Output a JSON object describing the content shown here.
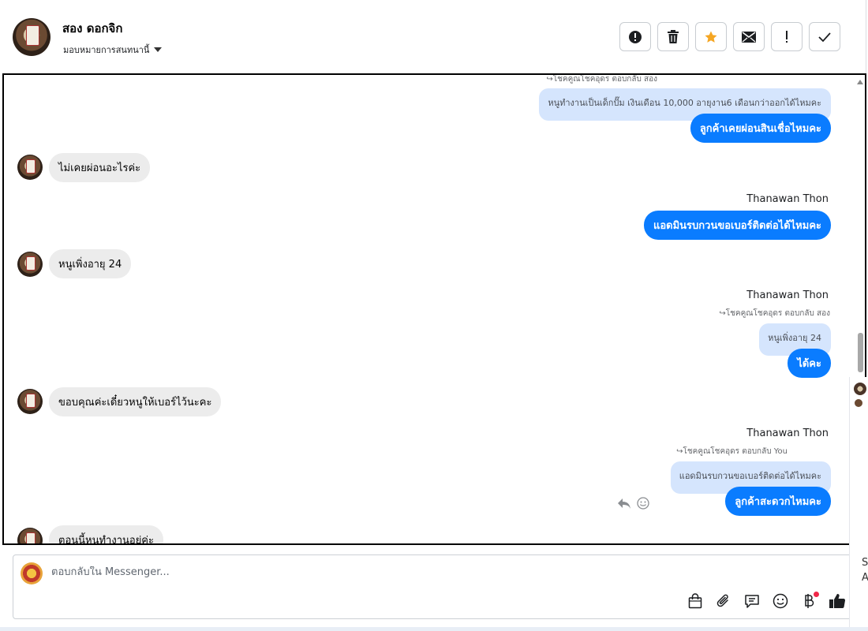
{
  "header": {
    "contact_name": "สอง ดอกจิก",
    "assign_label": "มอบหมายการสนทนานี้"
  },
  "toolbar": {
    "buttons": [
      "exclamation-circle-icon",
      "trash-icon",
      "star-icon",
      "envelope-icon",
      "exclamation-icon",
      "check-icon"
    ],
    "accent_star": "#f5a623"
  },
  "messages": {
    "m1": {
      "reply_meta": "↪โชคคูณโชคอุดร ตอบกลับ สอง",
      "quoted": "หนูทำงานเป็นเด็กปั๊ม เงินเดือน 10,000 อายุงาน6 เดือนกว่าออกได้ไหมคะ",
      "text": "ลูกค้าเคยผ่อนสินเชื่อไหมคะ"
    },
    "m2": {
      "text": "ไม่เคยผ่อนอะไรค่ะ"
    },
    "m3": {
      "sender": "Thanawan Thon",
      "text": "แอดมินรบกวนขอเบอร์ติดต่อได้ไหมคะ"
    },
    "m4": {
      "text": "หนูเพิ่งอายุ 24"
    },
    "m5": {
      "sender": "Thanawan Thon",
      "reply_meta": "↪โชคคูณโชคอุดร ตอบกลับ สอง",
      "quoted": "หนูเพิ่งอายุ 24",
      "text": "ได้คะ"
    },
    "m6": {
      "text": "ขอบคุณค่ะเดี๋ยวหนูให้เบอร์ไว้นะคะ"
    },
    "m7": {
      "sender": "Thanawan Thon",
      "reply_meta": "↪โชคคูณโชคอุดร ตอบกลับ You",
      "quoted": "แอดมินรบกวนขอเบอร์ติดต่อได้ไหมคะ",
      "text": "ลูกค้าสะดวกไหมคะ"
    },
    "m8": {
      "text": "ตอนนี้หนูทำงานอยู่ค่ะ"
    }
  },
  "composer": {
    "placeholder": "ตอบกลับใน Messenger...",
    "tools": [
      "shopping-bag-icon",
      "paperclip-icon",
      "saved-reply-icon",
      "emoji-icon",
      "baht-icon",
      "thumbs-up-icon"
    ]
  },
  "side_peek": {
    "line1": "S",
    "line2": "A"
  },
  "colors": {
    "outgoing_bubble": "#0a7cff",
    "quoted_bubble": "#d5e5fd",
    "incoming_bubble": "#ececec"
  }
}
